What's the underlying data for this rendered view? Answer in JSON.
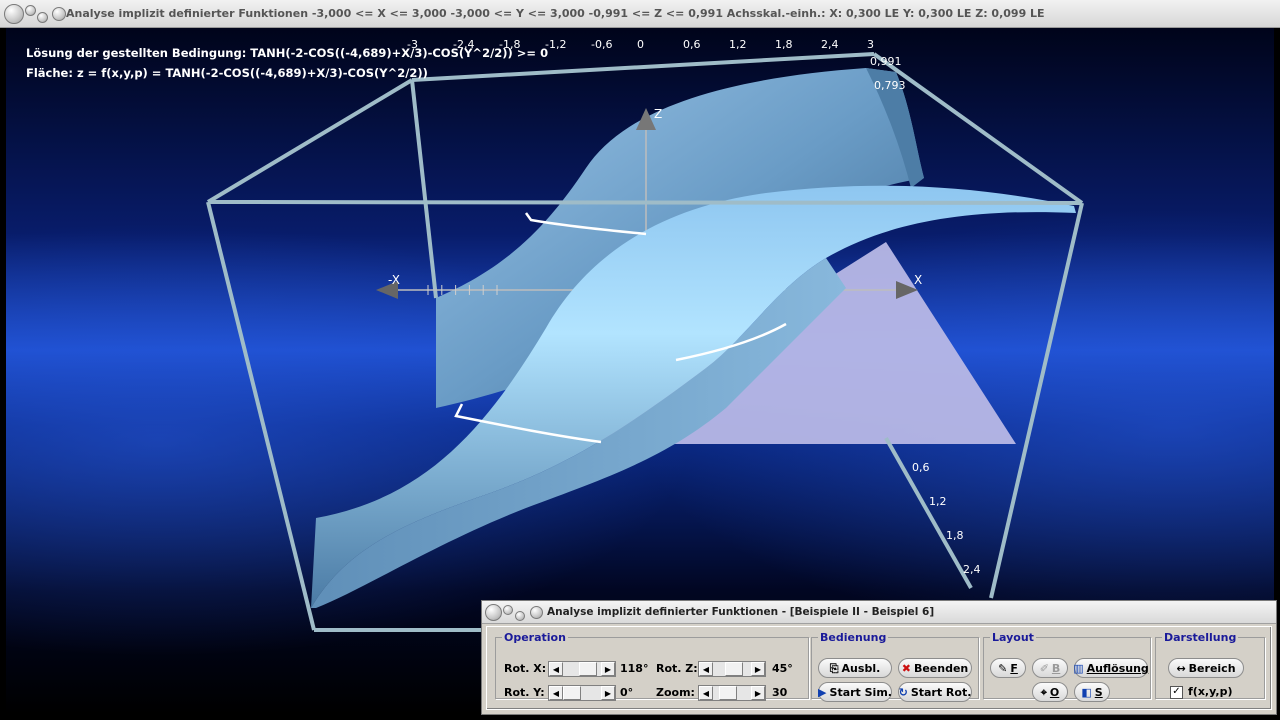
{
  "window": {
    "title": "Analyse implizit definierter Funktionen   -3,000 <= X <= 3,000   -3,000 <= Y <= 3,000   -0,991 <= Z <= 0,991   Achsskal.-einh.:  X: 0,300 LE    Y: 0,300 LE    Z: 0,099 LE"
  },
  "info": {
    "line1": "Lösung der gestellten Bedingung: TANH(-2-COS((-4,689)+X/3)-COS(Y^2/2)) >= 0",
    "line2": "Fläche: z = f(x,y,p) = TANH(-2-COS((-4,689)+X/3)-COS(Y^2/2))"
  },
  "plot": {
    "x_ticks": [
      "-3",
      "-2,4",
      "-1,8",
      "-1,2",
      "-0,6",
      "0",
      "0,6",
      "1,2",
      "1,8",
      "2,4",
      "3"
    ],
    "y_ticks": [
      "0,6",
      "1,2",
      "1,8",
      "2,4"
    ],
    "z_ticks": [
      "0,991",
      "0,793"
    ],
    "axis_labels": {
      "x_pos": "X",
      "x_neg": "-X",
      "z": "Z",
      "y": "Y"
    },
    "colors": {
      "surface": "#6e9ec8",
      "surface_highlight": "#aee0ff",
      "box": "#a6c4d0",
      "plane": "#b8b8e6"
    }
  },
  "panel": {
    "title": "Analyse implizit definierter Funktionen - [Beispiele II - Beispiel 6]",
    "operation": {
      "legend": "Operation",
      "rot_x_label": "Rot. X:",
      "rot_x_value": "118°",
      "rot_y_label": "Rot. Y:",
      "rot_y_value": "0°",
      "rot_z_label": "Rot. Z:",
      "rot_z_value": "45°",
      "zoom_label": "Zoom:",
      "zoom_value": "30"
    },
    "bedienung": {
      "legend": "Bedienung",
      "ausbl": "Ausbl.",
      "beenden": "Beenden",
      "start_sim": "Start Sim.",
      "start_rot": "Start Rot."
    },
    "layout": {
      "legend": "Layout",
      "f": "F",
      "b": "B",
      "aufloesung": "Auflösung",
      "o": "O",
      "s": "S"
    },
    "darstellung": {
      "legend": "Darstellung",
      "bereich": "Bereich",
      "fxyp_label": "f(x,y,p)",
      "fxyp_checked": "✓"
    }
  }
}
